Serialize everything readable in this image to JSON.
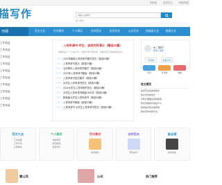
{
  "topbar": {
    "links": [
      "手机站",
      "会员中心",
      "网站导航"
    ]
  },
  "logo": {
    "text": "描写作"
  },
  "search": {
    "placeholder": "请输入关键字",
    "button_icon": "search-icon",
    "hot": "热门搜索"
  },
  "nav": {
    "current": "作网",
    "items": [
      "范文大全",
      "写作素材",
      "个人简历",
      "合同范本",
      "优秀作文",
      "公文写作",
      "祝福语大全",
      "教案大全"
    ]
  },
  "side": {
    "items": [
      "工作总结",
      "工作总结",
      "工作总结",
      "工作总结",
      "工作总结",
      "工作总结",
      "工作总结",
      "工作总结",
      "工作总结",
      "工作总结"
    ]
  },
  "feature": {
    "headline": "入党申请书 学生，该类优秀满分（精选20篇）",
    "desc": "我要的是一个人的才华，如果才学不能实现，就要靠自己的勤奋和努力",
    "items": [
      "2022年最新入党申请书格式范文（精选20篇）",
      "入党申请书范文（精选20篇）",
      "当代青年入党申请书格式（精选20篇）",
      "2020年入党申请书模板（精选20篇）",
      "入党申请书范文格式（精选20篇）",
      "大学生入党申请书范文（精选20篇）",
      "2022大学生入党申请书范文（精选20篇）",
      "大学生入党申请书模板1500字（精选20篇）",
      "精品版大学生入党申请书（精选20篇）",
      "入党申请书模板（精选20篇）",
      "入党申请书 大学生入党申请书范文（精选20篇）"
    ]
  },
  "user": {
    "greeting": "Hi，您好！",
    "link": "登录 | 注册",
    "btn1": "写文章",
    "btn2": "我的空间",
    "icons": [
      "签到",
      "写文章",
      "收藏"
    ]
  },
  "news": {
    "title": "软文撰写",
    "items": [
      "如何写出优质的软文",
      "软文写作的技巧",
      "写软文需要注意的事项",
      "软文营销的作用是什么",
      "如何提高软文的质量",
      "软文写作常用方法"
    ]
  },
  "cards": [
    {
      "title": "范文大全",
      "lines": [
        "工作总结",
        "工作计划",
        "心得体会"
      ]
    },
    {
      "title": "个人简历",
      "lines": [
        "求职简历",
        "简历模板",
        "自我评价"
      ]
    },
    {
      "title": "写作素材",
      "lines": [
        "名言警句",
        "优美句子",
        "经典语录"
      ]
    },
    {
      "title": "合同范本",
      "lines": [
        "劳动合同",
        "租赁合同",
        "购销合同"
      ]
    },
    {
      "title": "励志语",
      "lines": [
        "励志名言",
        "人生感悟",
        "正能量"
      ]
    }
  ],
  "bottom": {
    "left": "嵩山顶",
    "mid": "心动",
    "right": "热门推荐"
  },
  "colors": {
    "accent": "#1f86c7",
    "nav": "#2a8ed0",
    "headline": "#d23a3a"
  }
}
